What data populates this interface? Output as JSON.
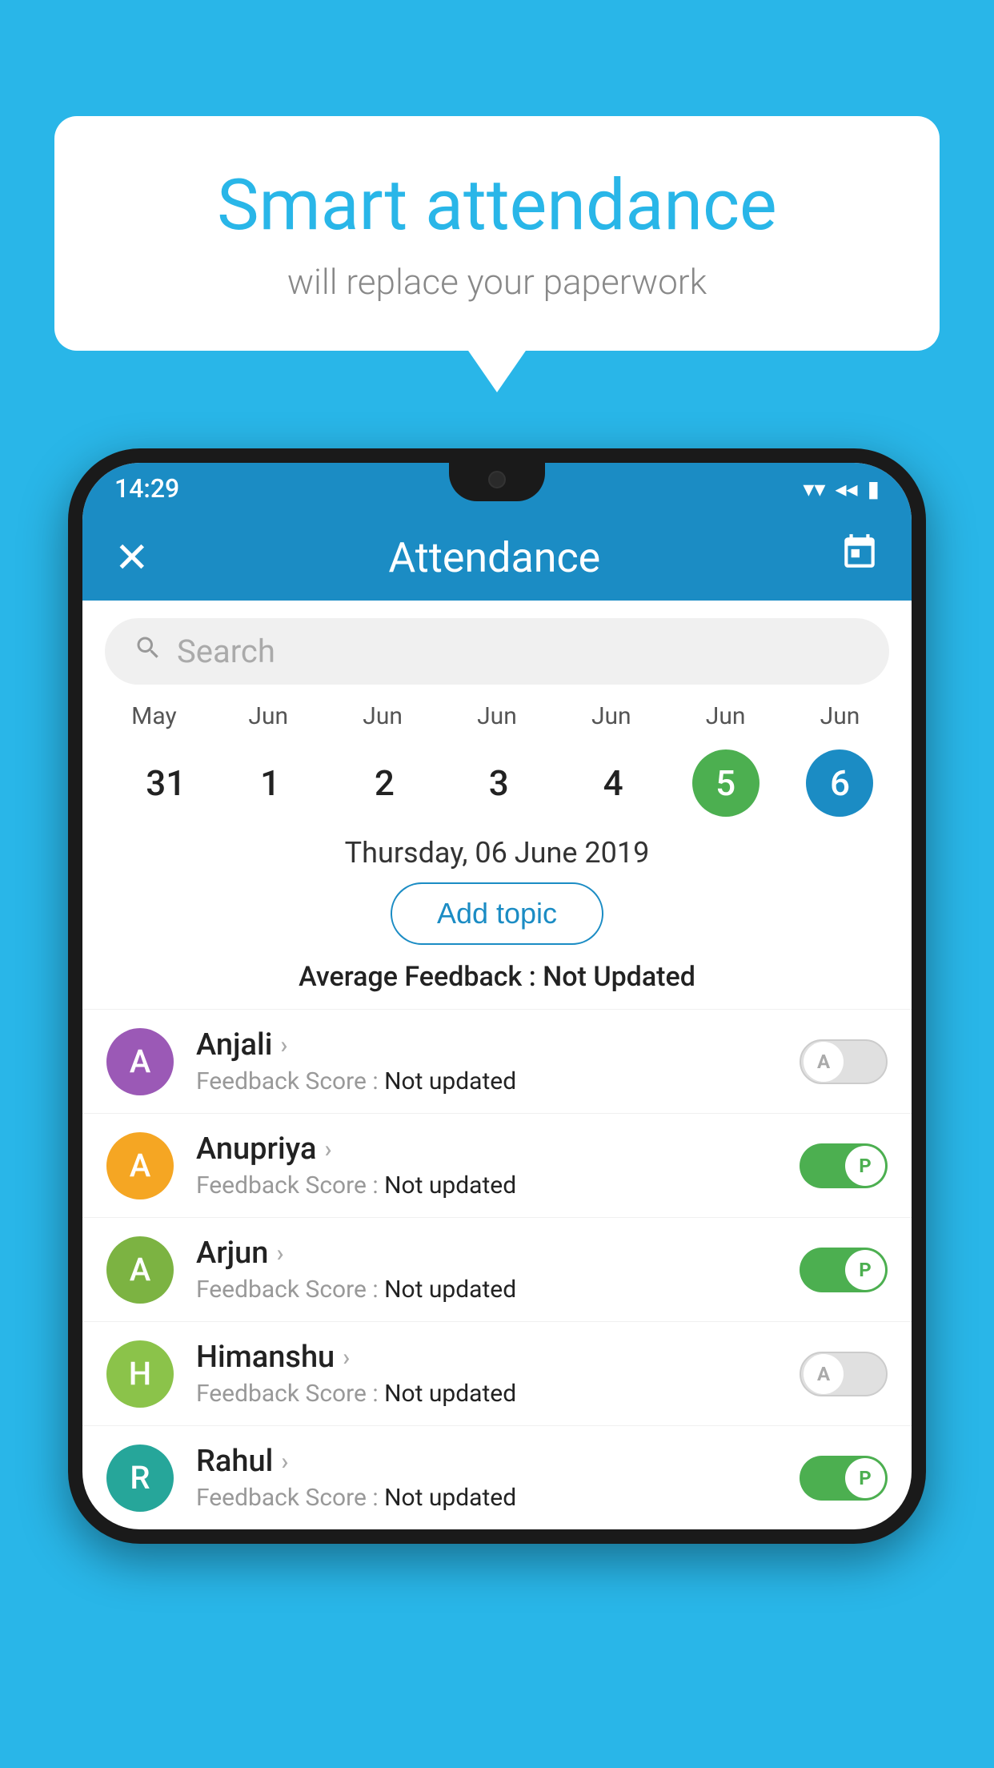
{
  "background_color": "#29B6E8",
  "bubble": {
    "title": "Smart attendance",
    "subtitle": "will replace your paperwork"
  },
  "status_bar": {
    "time": "14:29",
    "wifi": "▼",
    "signal": "◄",
    "battery": "▮"
  },
  "header": {
    "title": "Attendance",
    "close_label": "✕",
    "calendar_icon": "📅"
  },
  "search": {
    "placeholder": "Search"
  },
  "calendar": {
    "months": [
      "May",
      "Jun",
      "Jun",
      "Jun",
      "Jun",
      "Jun",
      "Jun"
    ],
    "dates": [
      "31",
      "1",
      "2",
      "3",
      "4",
      "5",
      "6"
    ],
    "selected_green_index": 5,
    "selected_blue_index": 6
  },
  "selected_date": "Thursday, 06 June 2019",
  "add_topic_label": "Add topic",
  "avg_feedback_label": "Average Feedback :",
  "avg_feedback_value": "Not Updated",
  "students": [
    {
      "name": "Anjali",
      "avatar_letter": "A",
      "avatar_color": "#9B59B6",
      "feedback_label": "Feedback Score :",
      "feedback_value": "Not updated",
      "toggle_state": "off",
      "toggle_letter": "A"
    },
    {
      "name": "Anupriya",
      "avatar_letter": "A",
      "avatar_color": "#F5A623",
      "feedback_label": "Feedback Score :",
      "feedback_value": "Not updated",
      "toggle_state": "on",
      "toggle_letter": "P"
    },
    {
      "name": "Arjun",
      "avatar_letter": "A",
      "avatar_color": "#7CB342",
      "feedback_label": "Feedback Score :",
      "feedback_value": "Not updated",
      "toggle_state": "on",
      "toggle_letter": "P"
    },
    {
      "name": "Himanshu",
      "avatar_letter": "H",
      "avatar_color": "#8BC34A",
      "feedback_label": "Feedback Score :",
      "feedback_value": "Not updated",
      "toggle_state": "off",
      "toggle_letter": "A"
    },
    {
      "name": "Rahul",
      "avatar_letter": "R",
      "avatar_color": "#26A69A",
      "feedback_label": "Feedback Score :",
      "feedback_value": "Not updated",
      "toggle_state": "on",
      "toggle_letter": "P"
    }
  ]
}
